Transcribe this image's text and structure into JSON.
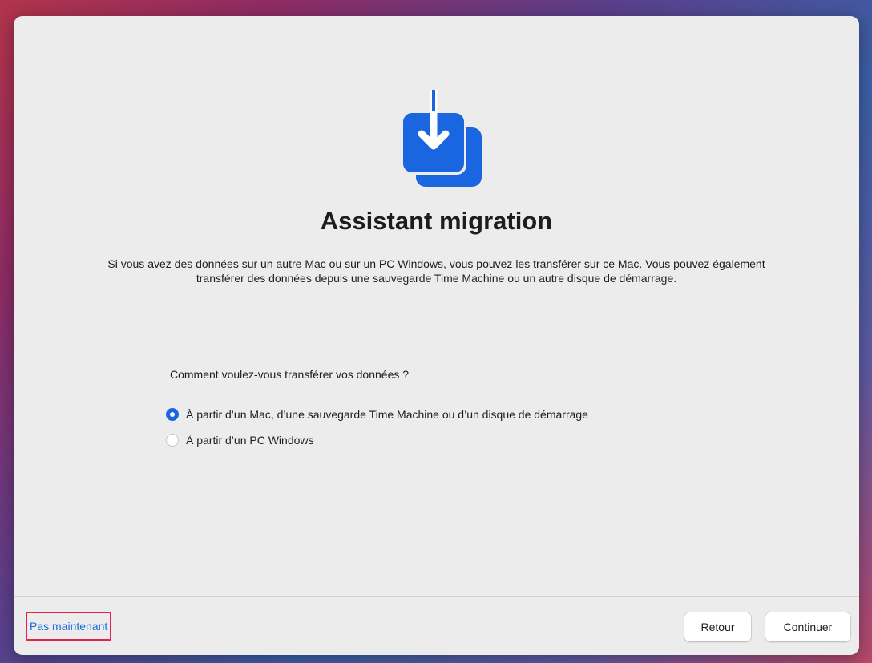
{
  "app": {
    "icon": "migration-assistant-icon",
    "accent_color": "#1a66e0",
    "title": "Assistant migration",
    "description": "Si vous avez des données sur un autre Mac ou sur un PC Windows, vous pouvez les transférer sur ce Mac. Vous pouvez également transférer des données depuis une sauvegarde Time Machine ou un autre disque de démarrage."
  },
  "transfer": {
    "question": "Comment voulez-vous transférer vos données ?",
    "options": [
      {
        "label": "À partir d’un Mac, d’une sauvegarde Time Machine ou d’un disque de démarrage",
        "selected": true
      },
      {
        "label": "À partir d’un PC Windows",
        "selected": false
      }
    ]
  },
  "footer": {
    "not_now_label": "Pas maintenant",
    "back_label": "Retour",
    "continue_label": "Continuer",
    "highlight_color": "#e0234f"
  }
}
